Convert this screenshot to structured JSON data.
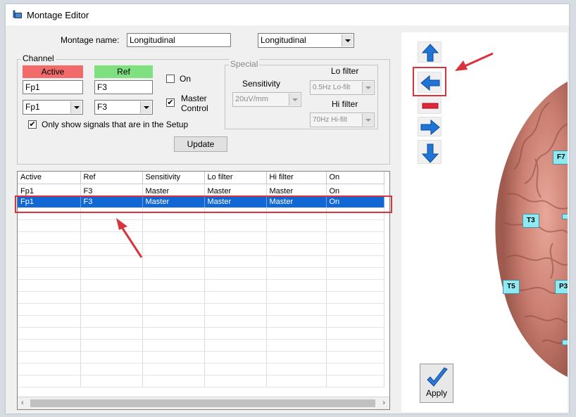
{
  "window": {
    "title": "Montage Editor"
  },
  "montage": {
    "name_label": "Montage name:",
    "name_value": "Longitudinal",
    "dropdown_value": "Longitudinal"
  },
  "channel": {
    "group_label": "Channel",
    "active_header": "Active",
    "ref_header": "Ref",
    "active_text": "Fp1",
    "ref_text": "F3",
    "active_dropdown": "Fp1",
    "ref_dropdown": "F3",
    "on_label": "On",
    "on_checked": false,
    "master_control_label_1": "Master",
    "master_control_label_2": "Control",
    "master_control_checked": true,
    "only_show_label": "Only show signals that are in the Setup",
    "only_show_checked": true,
    "update_button": "Update",
    "active_color": "#f26b6b",
    "ref_color": "#7ee07e"
  },
  "special": {
    "group_label": "Special",
    "sensitivity_label": "Sensitivity",
    "sensitivity_value": "20uV/mm",
    "lo_filter_label": "Lo filter",
    "lo_filter_value": "0.5Hz Lo-filt",
    "hi_filter_label": "Hi filter",
    "hi_filter_value": "70Hz Hi-filt"
  },
  "table": {
    "columns": [
      "Active",
      "Ref",
      "Sensitivity",
      "Lo filter",
      "Hi filter",
      "On"
    ],
    "rows": [
      [
        "Fp1",
        "F3",
        "Master",
        "Master",
        "Master",
        "On"
      ],
      [
        "Fp1",
        "F3",
        "Master",
        "Master",
        "Master",
        "On"
      ]
    ],
    "selected_row": 1
  },
  "nav": {
    "icons": [
      "arrow-up-icon",
      "arrow-left-icon",
      "minus-icon",
      "arrow-right-icon",
      "arrow-down-icon"
    ],
    "arrow_color": "#1f74d6",
    "minus_color": "#e0283a"
  },
  "electrodes": [
    "F7",
    "T3",
    "T5",
    "P3"
  ],
  "apply_button": "Apply",
  "annotation_color": "#d9343d"
}
